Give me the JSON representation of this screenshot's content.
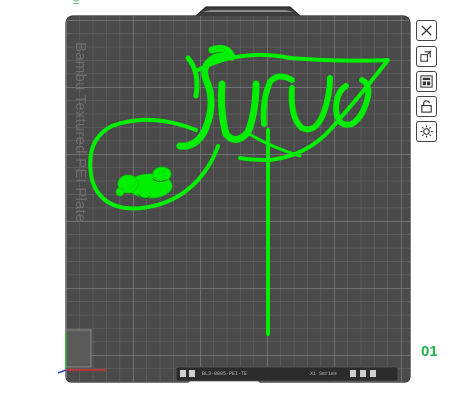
{
  "app": {
    "plate_type_label": "Bambu Textured PEI Plate",
    "plate_number": "01",
    "corner_mark": "="
  },
  "model": {
    "text_art": "Surya"
  },
  "plate_bottom_strip": {
    "left_text": "BL3-8805-PEI-TE",
    "right_text": "X1 Series"
  },
  "toolbar": {
    "items": [
      {
        "name": "close-plate",
        "icon": "close-icon"
      },
      {
        "name": "auto-orient",
        "icon": "orient-icon"
      },
      {
        "name": "arrange",
        "icon": "arrange-icon"
      },
      {
        "name": "lock-plate",
        "icon": "lock-icon"
      },
      {
        "name": "plate-settings",
        "icon": "gear-icon"
      }
    ]
  },
  "colors": {
    "plate_bg": "#4a4a4a",
    "grid": "#7b7b7b",
    "model": "#00ee00",
    "plate_number": "#22b14c"
  }
}
